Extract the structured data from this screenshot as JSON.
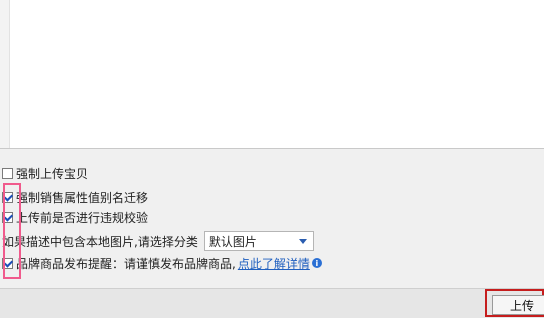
{
  "options": {
    "force_upload": {
      "label": "强制上传宝贝",
      "checked": false
    },
    "force_alias_migration": {
      "label": "强制销售属性值别名迁移",
      "checked": true
    },
    "check_violation": {
      "label": "上传前是否进行违规校验",
      "checked": true
    },
    "local_image_prefix": "如果",
    "local_image_text": "描述中包含本地图片,请选择分类",
    "image_category": {
      "selected": "默认图片"
    },
    "brand_reminder": {
      "label": "品牌商品发布提醒：请谨慎发布品牌商品,",
      "link": "点此了解详情",
      "checked": true
    }
  },
  "footer": {
    "upload_label": "上传"
  },
  "colors": {
    "highlight_pink": "#f05a8c",
    "highlight_red": "#c51d1d",
    "link": "#1f5fbf"
  },
  "icons": {
    "info": "info-icon",
    "dropdown": "chevron-down-icon"
  }
}
